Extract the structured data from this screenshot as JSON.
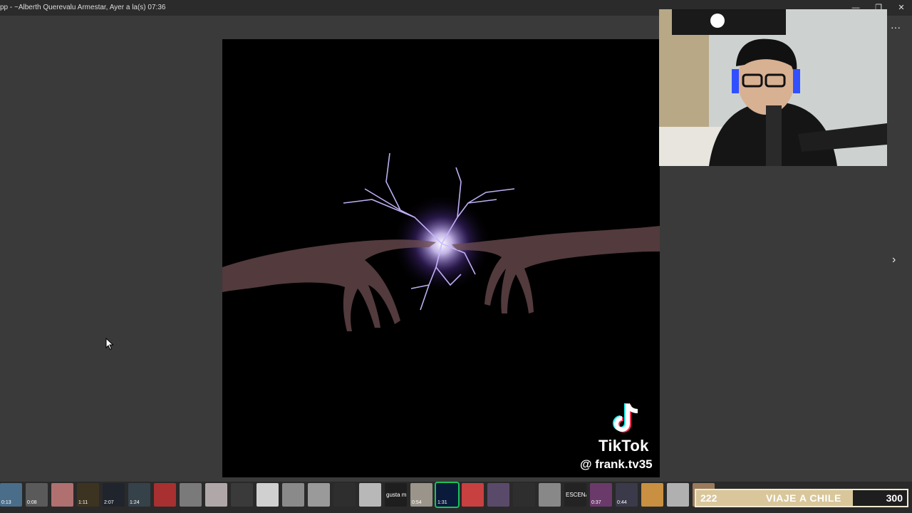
{
  "window": {
    "title": "pp - ~Alberth Querevalu Armestar, Ayer a la(s) 07:36",
    "minimize_glyph": "—",
    "restore_glyph": "❐",
    "close_glyph": "✕"
  },
  "viewer": {
    "more_options_glyph": "···",
    "next_glyph": "›",
    "watermark": {
      "brand": "TikTok",
      "handle": "@ frank.tv35",
      "icon": "tiktok-icon"
    }
  },
  "filmstrip": {
    "thumbs": [
      {
        "color": "#4a6d8a",
        "duration": "0:13"
      },
      {
        "color": "#5a5a5a",
        "duration": "0:08"
      },
      {
        "color": "#b07070",
        "duration": ""
      },
      {
        "color": "#3c3420",
        "duration": "1:11"
      },
      {
        "color": "#20242c",
        "duration": "2:07"
      },
      {
        "color": "#36424a",
        "duration": "1:24"
      },
      {
        "color": "#a83030",
        "duration": ""
      },
      {
        "color": "#7a7a7a",
        "duration": ""
      },
      {
        "color": "#b0a8a8",
        "duration": ""
      },
      {
        "color": "#3a3a3a",
        "duration": ""
      },
      {
        "color": "#d0d0d0",
        "duration": ""
      },
      {
        "color": "#8a8a8a",
        "duration": ""
      },
      {
        "color": "#9a9a9a",
        "duration": ""
      },
      {
        "color": "#2e2e2e",
        "duration": ""
      },
      {
        "color": "#b8b8b8",
        "duration": ""
      },
      {
        "color": "#1e1e1e",
        "duration": "",
        "text": "gusta m"
      },
      {
        "color": "#9a948a",
        "duration": "0:54"
      },
      {
        "color": "#0a1a3a",
        "duration": "1:31",
        "active": true
      },
      {
        "color": "#c84040",
        "duration": ""
      },
      {
        "color": "#5a4a6a",
        "duration": ""
      },
      {
        "color": "#2e2e2e",
        "duration": ""
      },
      {
        "color": "#888888",
        "duration": ""
      },
      {
        "color": "#232323",
        "duration": "",
        "text": "ESCENA"
      },
      {
        "color": "#6a3a6a",
        "duration": "0:37"
      },
      {
        "color": "#3a3a4a",
        "duration": "0:44"
      },
      {
        "color": "#c89040",
        "duration": ""
      },
      {
        "color": "#b0b0b0",
        "duration": ""
      },
      {
        "color": "#9a7a5a",
        "duration": ""
      }
    ]
  },
  "overlay": {
    "count": "222",
    "label": "VIAJE A CHILE",
    "goal": "300",
    "colors": {
      "bar": "#d9c79b",
      "goal_bg": "#1e1e1e"
    }
  }
}
